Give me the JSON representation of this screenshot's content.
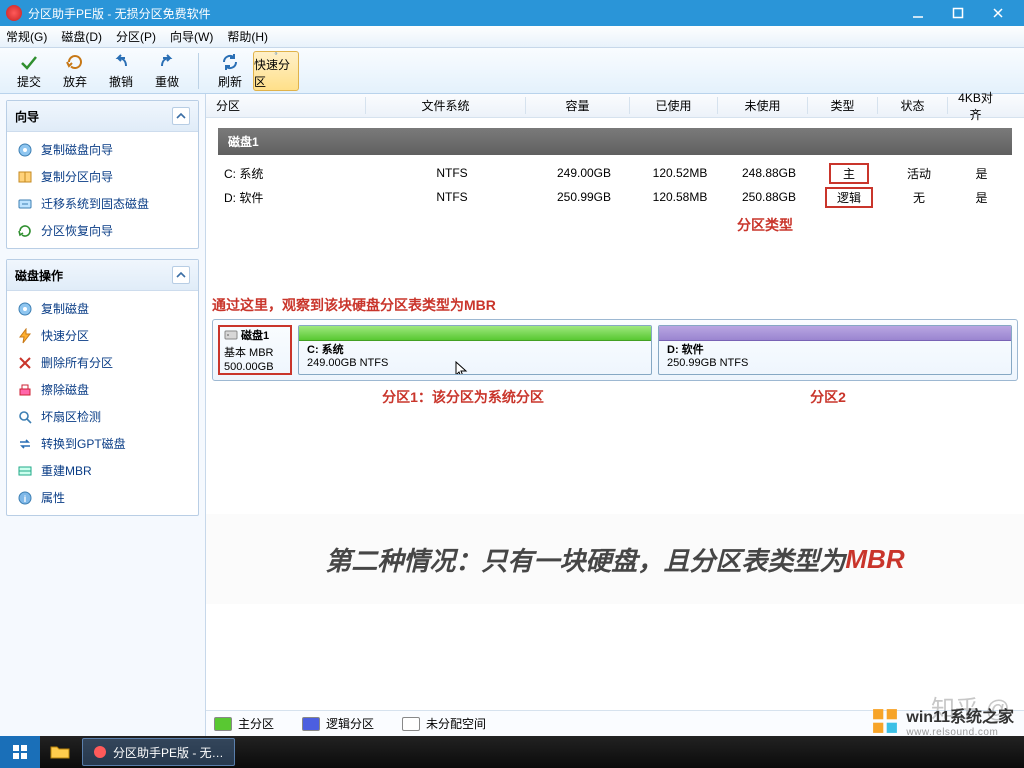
{
  "title": "分区助手PE版 - 无损分区免费软件",
  "menus": [
    "常规(G)",
    "磁盘(D)",
    "分区(P)",
    "向导(W)",
    "帮助(H)"
  ],
  "toolbar": {
    "commit": "提交",
    "discard": "放弃",
    "undo": "撤销",
    "redo": "重做",
    "refresh": "刷新",
    "quick": "快速分区"
  },
  "sidebar": {
    "wizard": {
      "title": "向导",
      "items": [
        "复制磁盘向导",
        "复制分区向导",
        "迁移系统到固态磁盘",
        "分区恢复向导"
      ]
    },
    "diskops": {
      "title": "磁盘操作",
      "items": [
        "复制磁盘",
        "快速分区",
        "删除所有分区",
        "擦除磁盘",
        "坏扇区检测",
        "转换到GPT磁盘",
        "重建MBR",
        "属性"
      ]
    }
  },
  "columns": [
    "分区",
    "文件系统",
    "容量",
    "已使用",
    "未使用",
    "类型",
    "状态",
    "4KB对齐"
  ],
  "disk_header": "磁盘1",
  "rows": [
    {
      "part": "C: 系统",
      "fs": "NTFS",
      "cap": "249.00GB",
      "used": "120.52MB",
      "free": "248.88GB",
      "type": "主",
      "state": "活动",
      "align": "是"
    },
    {
      "part": "D: 软件",
      "fs": "NTFS",
      "cap": "250.99GB",
      "used": "120.58MB",
      "free": "250.88GB",
      "type": "逻辑",
      "state": "无",
      "align": "是"
    }
  ],
  "type_annotation": "分区类型",
  "observe_line": "通过这里，观察到该块硬盘分区表类型为MBR",
  "diskblock": {
    "name": "磁盘1",
    "sub": "基本 MBR",
    "size": "500.00GB"
  },
  "parts": [
    {
      "name": "C: 系统",
      "size": "249.00GB NTFS"
    },
    {
      "name": "D: 软件",
      "size": "250.99GB NTFS"
    }
  ],
  "under_annot": [
    "分区1：该分区为系统分区",
    "分区2"
  ],
  "banner_pre": "第二种情况：只有一块硬盘，且分区表类型为",
  "banner_red": "MBR",
  "legend": [
    "主分区",
    "逻辑分区",
    "未分配空间"
  ],
  "wm_zhihu": "知乎 @",
  "wm_site": "win11系统之家",
  "wm_domain": "www.relsound.com",
  "taskbar_app": "分区助手PE版 - 无…"
}
